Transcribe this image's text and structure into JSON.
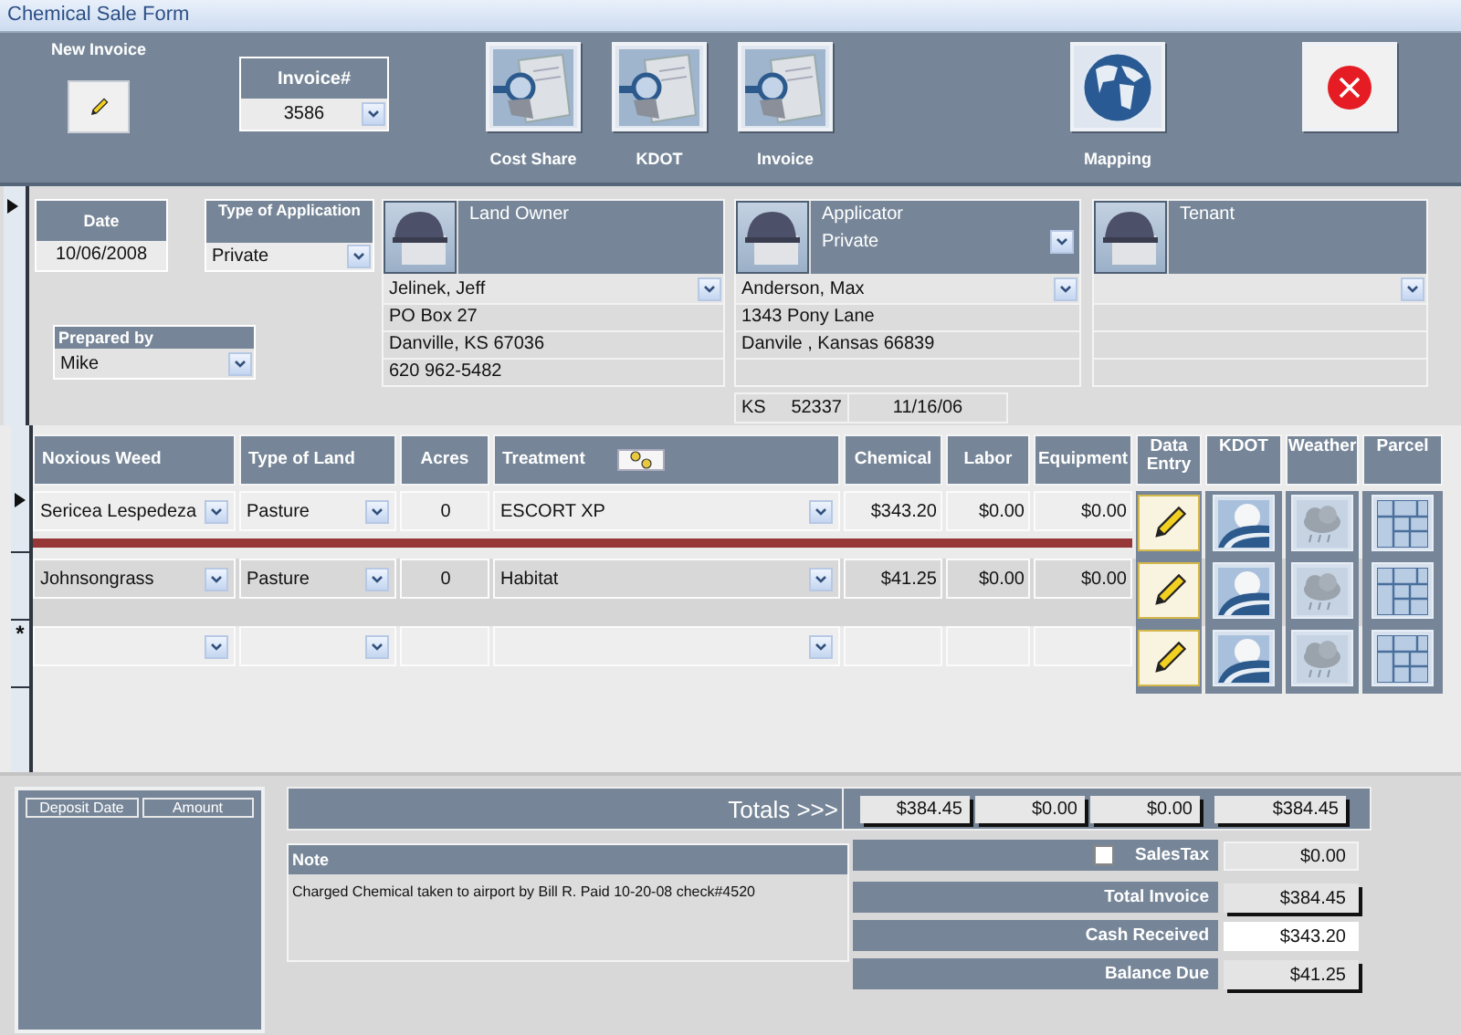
{
  "window": {
    "title": "Chemical Sale Form"
  },
  "toolbar": {
    "new_invoice": {
      "label": "New Invoice"
    },
    "invoice_number": {
      "label": "Invoice#",
      "value": "3586"
    },
    "buttons": [
      {
        "label": "Cost Share",
        "kind": "report"
      },
      {
        "label": "KDOT",
        "kind": "report"
      },
      {
        "label": "Invoice",
        "kind": "report"
      },
      {
        "label": "Mapping",
        "kind": "globe"
      }
    ]
  },
  "form": {
    "date": {
      "label": "Date",
      "value": "10/06/2008"
    },
    "application_type": {
      "label": "Type of Application",
      "value": "Private"
    },
    "prepared_by": {
      "label": "Prepared by",
      "value": "Mike"
    }
  },
  "parties": [
    {
      "label": "Land Owner",
      "name": "Jelinek, Jeff",
      "lines": [
        "PO Box 27",
        "Danville, KS  67036",
        "620 962-5482"
      ]
    },
    {
      "label": "Applicator",
      "type": "Private",
      "name": "Anderson, Max",
      "lines": [
        "1343 Pony Lane",
        "Danvile , Kansas 66839"
      ],
      "license": {
        "state": "KS",
        "number": "52337",
        "expires": "11/16/06"
      }
    },
    {
      "label": "Tenant"
    }
  ],
  "line_items": {
    "columns": [
      "Noxious Weed",
      "Type of Land",
      "Acres",
      "Treatment",
      "Chemical",
      "Labor",
      "Equipment",
      "Data Entry",
      "KDOT",
      "Weather",
      "Parcel"
    ],
    "rows": [
      {
        "weed": "Sericea Lespedeza",
        "land": "Pasture",
        "acres": "0",
        "treatment": "ESCORT XP",
        "chemical": "$343.20",
        "labor": "$0.00",
        "equipment": "$0.00",
        "selected": true
      },
      {
        "weed": "Johnsongrass",
        "land": "Pasture",
        "acres": "0",
        "treatment": "Habitat",
        "chemical": "$41.25",
        "labor": "$0.00",
        "equipment": "$0.00",
        "selected": false
      }
    ],
    "new_row_marker": "*"
  },
  "deposits": {
    "columns": [
      "Deposit Date",
      "Amount"
    ]
  },
  "totals": {
    "label": "Totals >>>",
    "values": [
      "$384.45",
      "$0.00",
      "$0.00",
      "$384.45"
    ]
  },
  "note": {
    "label": "Note",
    "text": "Charged Chemical taken to airport by Bill R. Paid 10-20-08 check#4520"
  },
  "summary": [
    {
      "kind": "checkbox",
      "label": "SalesTax",
      "value": "$0.00",
      "checked": false
    },
    {
      "kind": "calc",
      "label": "Total Invoice",
      "value": "$384.45"
    },
    {
      "kind": "input",
      "label": "Cash Received",
      "value": "$343.20"
    },
    {
      "kind": "calc",
      "label": "Balance Due",
      "value": "$41.25"
    }
  ]
}
